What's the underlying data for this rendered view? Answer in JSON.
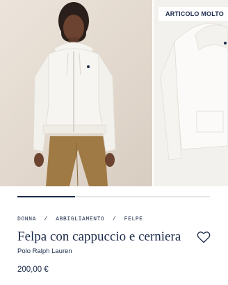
{
  "gallery": {
    "badge": "ARTICOLO MOLTO",
    "progress": 0.3,
    "images": [
      {
        "icon": "model-wearing-zip-hoodie-photo"
      },
      {
        "icon": "hoodie-product-photo"
      }
    ]
  },
  "breadcrumb": {
    "items": [
      "DONNA",
      "ABBIGLIAMENTO",
      "FELPE"
    ],
    "separator": "/"
  },
  "product": {
    "title": "Felpa con cappuccio e cerniera",
    "brand": "Polo Ralph Lauren",
    "price": "200,00 €"
  },
  "actions": {
    "wishlist_icon": "heart-outline-icon"
  },
  "colors": {
    "navy": "#1b2a4a",
    "photo_bg": "#e2d8cd",
    "garment": "#f6f4f0",
    "pants": "#a07a45"
  }
}
